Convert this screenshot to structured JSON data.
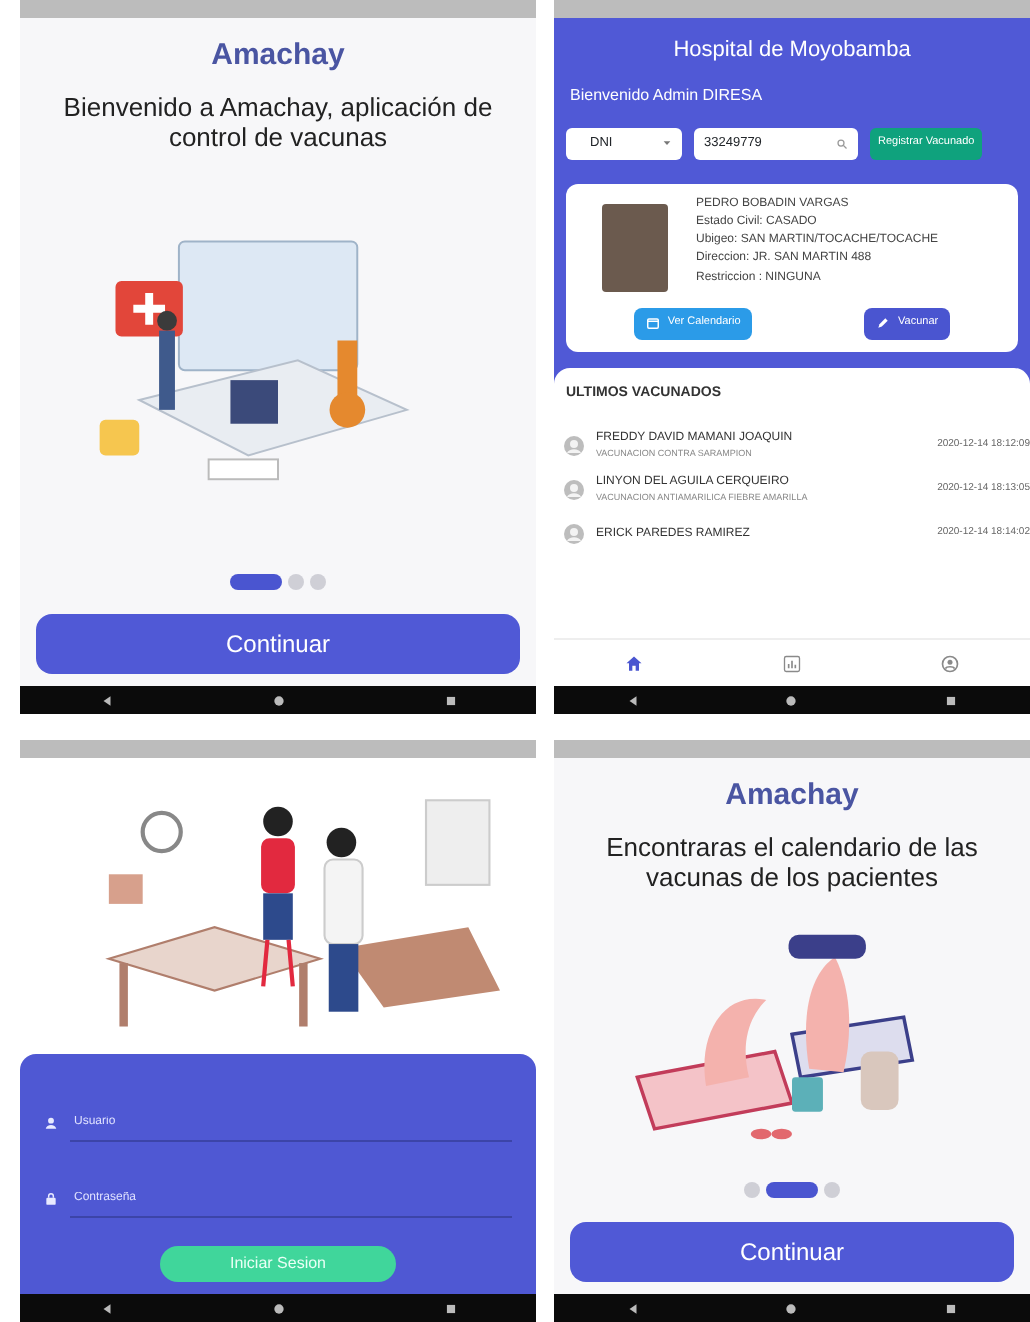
{
  "screens": [
    {
      "kind": "onboarding",
      "title": "Amachay",
      "subtitle": "Bienvenido a Amachay, aplicación de control de vacunas",
      "pages": [
        {
          "selected": true
        },
        {
          "selected": false
        },
        {
          "selected": false
        }
      ],
      "button": "Continuar"
    },
    {
      "kind": "home",
      "title": "Hospital de Moyobamba",
      "welcome": "Bienvenido Admin DIRESA",
      "doc_type": "DNI",
      "search_value": "33249779",
      "register_button": "Registrar Vacunado",
      "patient": {
        "lines": [
          "PEDRO BOBADIN VARGAS",
          "Estado Civil: CASADO",
          "Ubigeo: SAN MARTIN/TOCACHE/TOCACHE",
          "Direccion: JR. SAN MARTIN 488",
          "Restriccion : NINGUNA"
        ],
        "calendar_button": "Ver Calendario",
        "vaccinate_button": "Vacunar"
      },
      "section_title": "ULTIMOS VACUNADOS",
      "recent": [
        {
          "name": "FREDDY DAVID MAMANI JOAQUIN",
          "detail": "VACUNACION CONTRA SARAMPION",
          "date": "2020-12-14 18:12:09"
        },
        {
          "name": "LINYON DEL AGUILA CERQUEIRO",
          "detail": "VACUNACION ANTIAMARILICA FIEBRE AMARILLA",
          "date": "2020-12-14 18:13:05"
        },
        {
          "name": "ERICK PAREDES RAMIREZ",
          "date": "2020-12-14 18:14:02"
        }
      ],
      "bottom_nav": [
        {
          "kind": "home",
          "selected": true
        },
        {
          "kind": "chart",
          "selected": false
        },
        {
          "kind": "account",
          "selected": false
        }
      ]
    },
    {
      "kind": "login",
      "user_placeholder": "Usuario",
      "password_placeholder": "Contraseña",
      "button": "Iniciar Sesion"
    },
    {
      "kind": "onboarding",
      "title": "Amachay",
      "subtitle": "Encontraras el calendario de las vacunas de los pacientes",
      "pages": [
        {
          "selected": false
        },
        {
          "selected": true
        },
        {
          "selected": false
        }
      ],
      "button": "Continuar"
    }
  ]
}
